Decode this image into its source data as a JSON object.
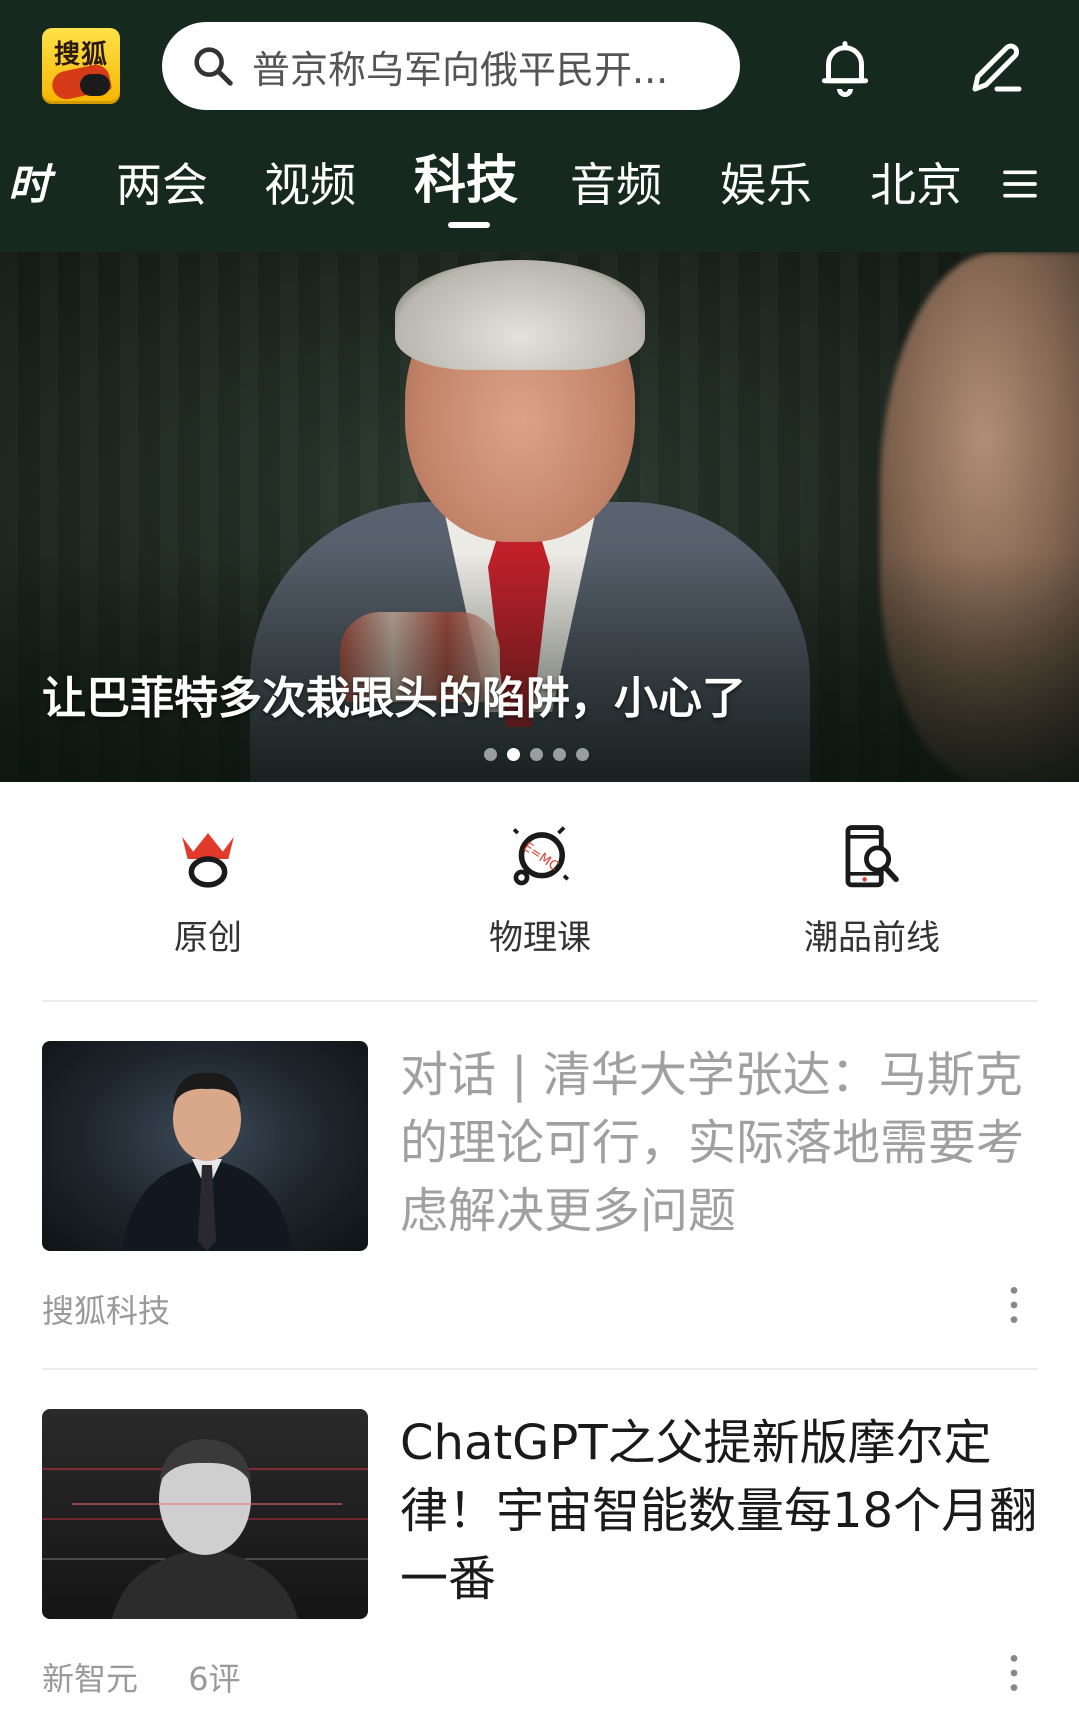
{
  "header": {
    "logo_text": "搜狐",
    "search_placeholder": "普京称乌军向俄平民开...",
    "bell_icon": "bell-icon",
    "edit_icon": "edit-icon"
  },
  "tabs": [
    {
      "label": "时"
    },
    {
      "label": "两会"
    },
    {
      "label": "视频"
    },
    {
      "label": "科技",
      "active": true
    },
    {
      "label": "音频"
    },
    {
      "label": "娱乐"
    },
    {
      "label": "北京"
    }
  ],
  "hero": {
    "title": "让巴菲特多次栽跟头的陷阱，小心了",
    "slide_count": 5,
    "active_slide": 2
  },
  "shortcuts": [
    {
      "label": "原创",
      "icon": "crown-icon"
    },
    {
      "label": "物理课",
      "icon": "physics-icon"
    },
    {
      "label": "潮品前线",
      "icon": "phone-search-icon"
    }
  ],
  "articles": [
    {
      "title": "对话 | 清华大学张达：马斯克的理论可行，实际落地需要考虑解决更多问题",
      "source": "搜狐科技",
      "comments": "",
      "title_color": "#a0a0a0"
    },
    {
      "title": "ChatGPT之父提新版摩尔定律！宇宙智能数量每18个月翻一番",
      "source": "新智元",
      "comments": "6评",
      "title_color": "#1a1a1a"
    }
  ],
  "colors": {
    "header_bg": "#16291f",
    "text_gray": "#9a9a9a",
    "accent_red": "#e03a2a"
  }
}
